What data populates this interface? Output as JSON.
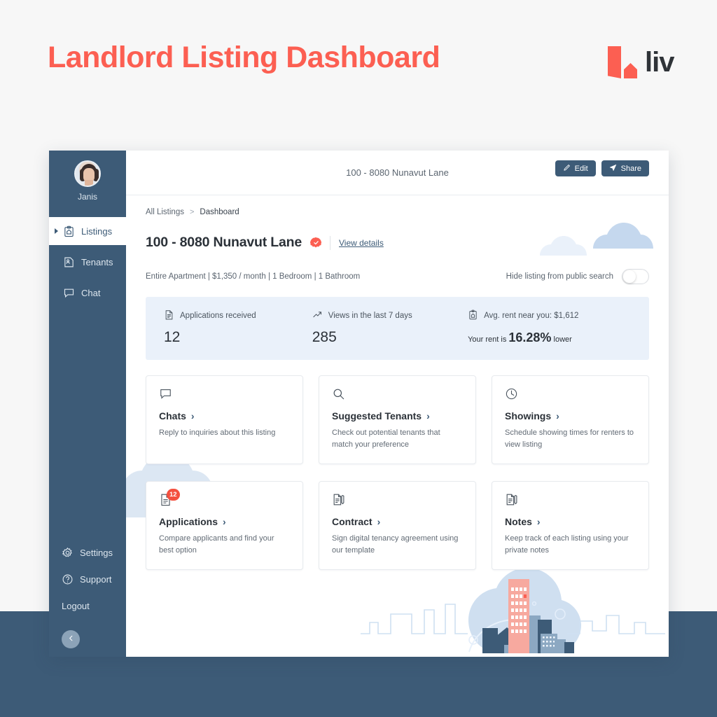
{
  "hero": {
    "title": "Landlord Listing Dashboard",
    "brand_word": "liv",
    "brand_color": "#fc5f52"
  },
  "sidebar": {
    "profile": {
      "name": "Janis",
      "avatar": "user-avatar"
    },
    "items": [
      {
        "label": "Listings",
        "icon": "clipboard-home-icon",
        "active": true
      },
      {
        "label": "Tenants",
        "icon": "tenant-document-icon",
        "active": false
      },
      {
        "label": "Chat",
        "icon": "chat-bubble-icon",
        "active": false
      }
    ],
    "bottom_items": [
      {
        "label": "Settings",
        "icon": "gear-icon"
      },
      {
        "label": "Support",
        "icon": "question-circle-icon"
      },
      {
        "label": "Logout",
        "icon": ""
      }
    ],
    "collapse_icon": "chevron-left-icon",
    "background": "#3d5b77"
  },
  "topbar": {
    "title": "100 - 8080 Nunavut Lane"
  },
  "breadcrumb": {
    "root": "All Listings",
    "separator": ">",
    "current": "Dashboard"
  },
  "actions": {
    "edit_label": "Edit",
    "edit_icon": "pencil-icon",
    "share_label": "Share",
    "share_icon": "paper-plane-icon"
  },
  "listing": {
    "title": "100 - 8080 Nunavut Lane",
    "verified_badge": "verified-check-icon",
    "view_details": "View details",
    "meta": "Entire Apartment | $1,350 / month | 1 Bedroom | 1 Bathroom",
    "hide_label": "Hide listing from public search",
    "hide_toggle_state": "off"
  },
  "stats": [
    {
      "icon": "application-document-icon",
      "label": "Applications received",
      "value": "12"
    },
    {
      "icon": "trending-up-icon",
      "label": "Views in the last 7 days",
      "value": "285"
    },
    {
      "icon": "clipboard-home-icon",
      "label": "Avg. rent near you: $1,612",
      "sub_prefix": "Your rent is",
      "sub_percent": "16.28%",
      "sub_suffix": "lower"
    }
  ],
  "cards": [
    {
      "icon": "chat-bubble-icon",
      "title": "Chats",
      "chevron": "›",
      "desc": "Reply to inquiries about this listing",
      "badge": ""
    },
    {
      "icon": "search-icon",
      "title": "Suggested Tenants",
      "chevron": "›",
      "desc": "Check out potential tenants that match your preference",
      "badge": ""
    },
    {
      "icon": "clock-icon",
      "title": "Showings",
      "chevron": "›",
      "desc": "Schedule showing times for renters to view listing",
      "badge": ""
    },
    {
      "icon": "application-document-icon",
      "title": "Applications",
      "chevron": "›",
      "desc": "Compare applicants and find your best option",
      "badge": "12"
    },
    {
      "icon": "contract-pen-icon",
      "title": "Contract",
      "chevron": "›",
      "desc": "Sign digital tenancy agreement using our template",
      "badge": ""
    },
    {
      "icon": "notes-pen-icon",
      "title": "Notes",
      "chevron": "›",
      "desc": "Keep track of each listing using your private notes",
      "badge": ""
    }
  ],
  "decorations": {
    "clouds": "cloud-shapes",
    "skyline": "city-skyline-illustration",
    "accent_color": "#fc5f52",
    "cloud_color": "#dce7f3"
  }
}
